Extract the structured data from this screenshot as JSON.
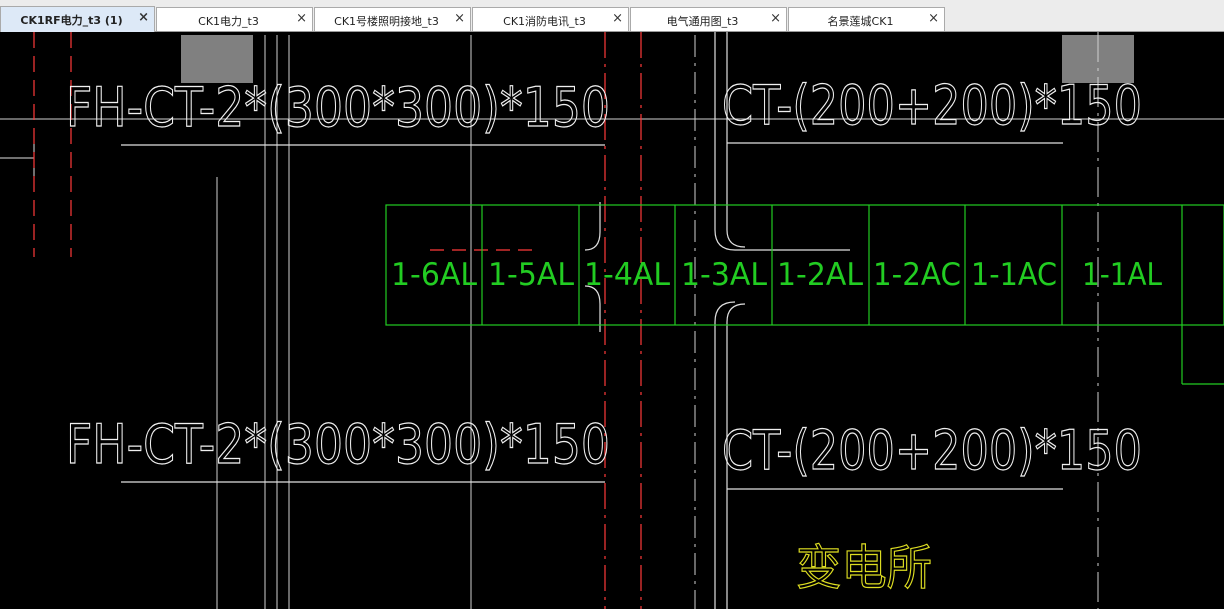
{
  "tabs": [
    {
      "label": "CK1RF电力_t3 (1)",
      "close": "×",
      "active": true
    },
    {
      "label": "CK1电力_t3",
      "close": "×",
      "active": false
    },
    {
      "label": "CK1号楼照明接地_t3",
      "close": "×",
      "active": false
    },
    {
      "label": "CK1消防电讯_t3",
      "close": "×",
      "active": false
    },
    {
      "label": "电气通用图_t3",
      "close": "×",
      "active": false
    },
    {
      "label": "名景莲城CK1",
      "close": "×",
      "active": false
    }
  ],
  "drawing": {
    "annotations": {
      "upper_left": "FH-CT-2*(300*300)*150",
      "upper_right": "CT-(200+200)*150",
      "lower_left": "FH-CT-2*(300*300)*150",
      "lower_right": "CT-(200+200)*150"
    },
    "panels": [
      "1-6AL",
      "1-5AL",
      "1-4AL",
      "1-3AL",
      "1-2AL",
      "1-2AC",
      "1-1AC",
      "1-1AL"
    ],
    "room_label": "变电所",
    "colors": {
      "background": "#000000",
      "lines": "#ffffff",
      "panels": "#22cc22",
      "hidden_lines": "#ff3030",
      "room_label": "#dddd22",
      "blocks": "#808080"
    }
  }
}
